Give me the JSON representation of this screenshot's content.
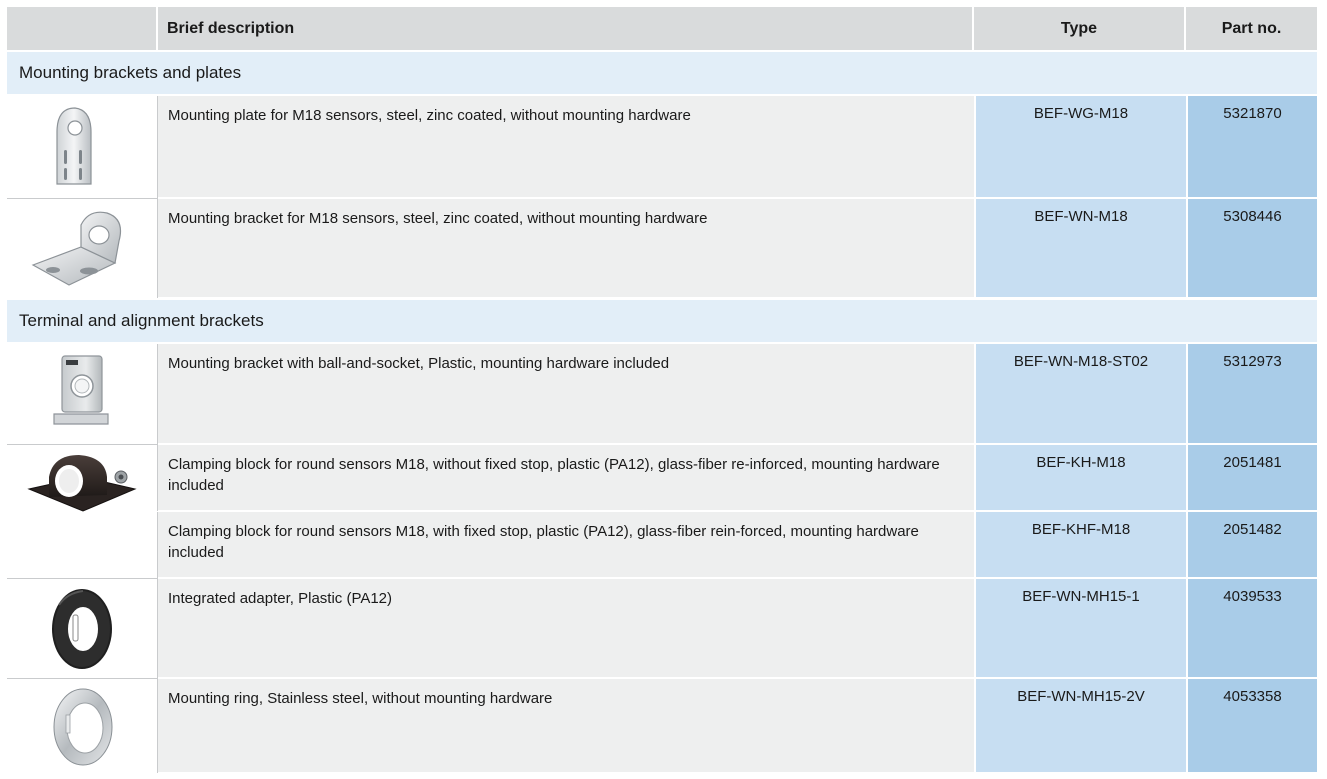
{
  "header": {
    "brief_description": "Brief description",
    "type": "Type",
    "part_no": "Part no."
  },
  "sections": [
    {
      "title": "Mounting brackets and plates",
      "rows": [
        {
          "description": "Mounting plate for M18 sensors, steel, zinc coated, without mounting hardware",
          "type": "BEF-WG-M18",
          "part_no": "5321870",
          "icon": "mounting-plate-icon"
        },
        {
          "description": "Mounting bracket for M18 sensors, steel, zinc coated, without mounting hardware",
          "type": "BEF-WN-M18",
          "part_no": "5308446",
          "icon": "mounting-bracket-icon"
        }
      ]
    },
    {
      "title": "Terminal and alignment brackets",
      "rows": [
        {
          "description": "Mounting bracket with ball-and-socket, Plastic, mounting hardware included",
          "type": "BEF-WN-M18-ST02",
          "part_no": "5312973",
          "icon": "ball-socket-bracket-icon"
        },
        {
          "description": "Clamping block for round sensors M18, without fixed stop, plastic (PA12), glass-fiber re-inforced, mounting hardware included",
          "type": "BEF-KH-M18",
          "part_no": "2051481",
          "icon": "clamping-block-icon"
        },
        {
          "description": "Clamping block for round sensors M18, with fixed stop, plastic (PA12), glass-fiber rein-forced, mounting hardware included",
          "type": "BEF-KHF-M18",
          "part_no": "2051482",
          "icon": ""
        },
        {
          "description": "Integrated adapter, Plastic (PA12)",
          "type": "BEF-WN-MH15-1",
          "part_no": "4039533",
          "icon": "integrated-adapter-icon"
        },
        {
          "description": "Mounting ring, Stainless steel, without mounting hardware",
          "type": "BEF-WN-MH15-2V",
          "part_no": "4053358",
          "icon": "mounting-ring-icon"
        }
      ]
    }
  ],
  "colors": {
    "header_bg": "#d9dbdc",
    "section_bg": "#e2eef8",
    "description_bg": "#eeefef",
    "type_bg": "#c7def2",
    "part_bg": "#a9cce8"
  }
}
